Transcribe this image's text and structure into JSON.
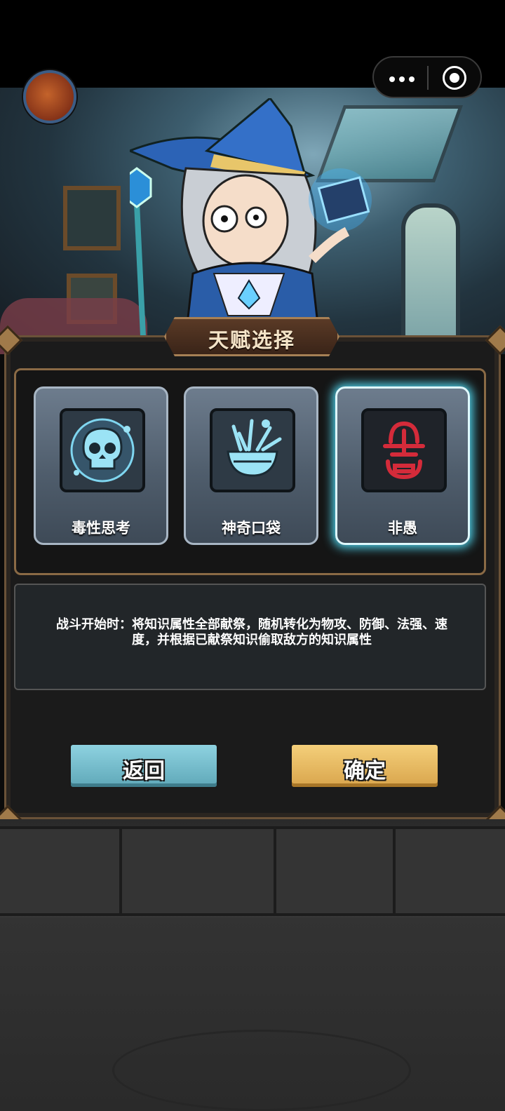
{
  "status_bar": {
    "menu_icon": "more-dots-icon",
    "close_icon": "target-close-icon"
  },
  "panel": {
    "title": "天赋选择",
    "talents": [
      {
        "label": "毒性思考",
        "icon": "poison-skull-icon",
        "selected": false
      },
      {
        "label": "神奇口袋",
        "icon": "magic-pouch-icon",
        "selected": false
      },
      {
        "label": "非愚",
        "icon": "red-rune-icon",
        "selected": true
      }
    ],
    "description": "战斗开始时：将知识属性全部献祭，随机转化为物攻、防御、法强、速度，并根据已献祭知识偷取敌方的知识属性",
    "back_label": "返回",
    "confirm_label": "确定"
  },
  "colors": {
    "accent_select": "#4fd2ea",
    "back_button": "#6fbccb",
    "confirm_button": "#e8bb60",
    "rune_red": "#d42b3a"
  }
}
